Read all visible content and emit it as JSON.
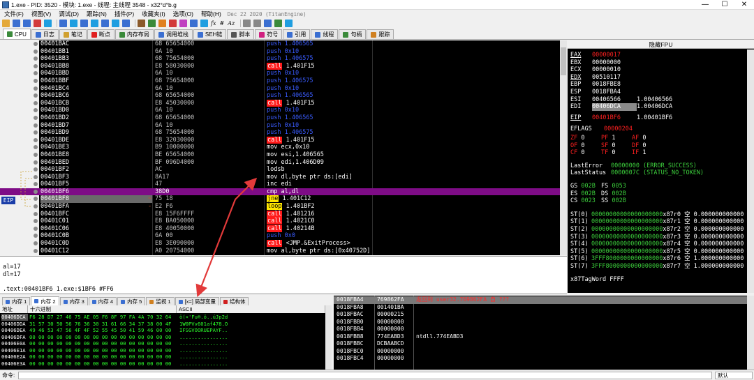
{
  "title": "1.exe - PID: 3520 - 模块: 1.exe - 线程: 主线程 3548 - x32°d°b.g",
  "window_buttons": [
    "—",
    "☐",
    "✕"
  ],
  "menu": [
    "文件(F)",
    "视图(V)",
    "调试(D)",
    "跟踪(N)",
    "插件(P)",
    "收藏夹(I)",
    "选项(O)",
    "帮助(H)"
  ],
  "build_date": "Dec 22 2020 (TitanEngine)",
  "toolbar_colors": [
    "#e4a93a",
    "#3b6fd1",
    "#3b6fd1",
    "#d23a3a",
    "#1f9ee0",
    "#3b6fd1",
    "#1f9ee0",
    "#3b6fd1",
    "#1f9ee0",
    "#3b6fd1",
    "#1f9ee0",
    "#3b6fd1",
    "#8b5a2b",
    "#3a8a3a",
    "#e08020",
    "#d23a3a",
    "#c040c0",
    "#3b6fd1",
    "#1f9ee0",
    "#888888",
    "#888888",
    "#3b6fd1",
    "#3a8a3a",
    "#1f9ee0"
  ],
  "toolbar_text": [
    "fx",
    "#",
    "Az"
  ],
  "tabs": [
    {
      "label": "CPU",
      "icon": "cpu-icon",
      "color": "#3a8a3a",
      "active": true
    },
    {
      "label": "日志",
      "icon": "log-icon",
      "color": "#3b6fd1"
    },
    {
      "label": "笔记",
      "icon": "notes-icon",
      "color": "#d0a030"
    },
    {
      "label": "断点",
      "icon": "breakpoint-icon",
      "color": "#e02020"
    },
    {
      "label": "内存布局",
      "icon": "memory-map-icon",
      "color": "#3a8a3a"
    },
    {
      "label": "调用堆栈",
      "icon": "call-stack-icon",
      "color": "#3b6fd1"
    },
    {
      "label": "SEH链",
      "icon": "seh-icon",
      "color": "#3b6fd1"
    },
    {
      "label": "脚本",
      "icon": "script-icon",
      "color": "#555555"
    },
    {
      "label": "符号",
      "icon": "symbol-icon",
      "color": "#d02080"
    },
    {
      "label": "引用",
      "icon": "references-icon",
      "color": "#3b6fd1"
    },
    {
      "label": "线程",
      "icon": "threads-icon",
      "color": "#3b6fd1"
    },
    {
      "label": "句柄",
      "icon": "handles-icon",
      "color": "#3a8a3a"
    },
    {
      "label": "跟踪",
      "icon": "trace-icon",
      "color": "#d08020"
    }
  ],
  "eip_label": "EIP",
  "disasm": [
    {
      "addr": "00401BAC",
      "bytes": "68 65654000",
      "op": "push",
      "arg": "1.406565"
    },
    {
      "addr": "00401BB1",
      "bytes": "6A 10",
      "op": "push",
      "arg": "0x10"
    },
    {
      "addr": "00401BB3",
      "bytes": "68 75654000",
      "op": "push",
      "arg": "1.406575"
    },
    {
      "addr": "00401BB8",
      "bytes": "E8 58030000",
      "op": "call",
      "arg": "1.401F15"
    },
    {
      "addr": "00401BBD",
      "bytes": "6A 10",
      "op": "push",
      "arg": "0x10"
    },
    {
      "addr": "00401BBF",
      "bytes": "68 75654000",
      "op": "push",
      "arg": "1.406575"
    },
    {
      "addr": "00401BC4",
      "bytes": "6A 10",
      "op": "push",
      "arg": "0x10"
    },
    {
      "addr": "00401BC6",
      "bytes": "68 65654000",
      "op": "push",
      "arg": "1.406565"
    },
    {
      "addr": "00401BCB",
      "bytes": "E8 45030000",
      "op": "call",
      "arg": "1.401F15"
    },
    {
      "addr": "00401BD0",
      "bytes": "6A 10",
      "op": "push",
      "arg": "0x10"
    },
    {
      "addr": "00401BD2",
      "bytes": "68 65654000",
      "op": "push",
      "arg": "1.406565"
    },
    {
      "addr": "00401BD7",
      "bytes": "6A 10",
      "op": "push",
      "arg": "0x10"
    },
    {
      "addr": "00401BD9",
      "bytes": "68 75654000",
      "op": "push",
      "arg": "1.406575"
    },
    {
      "addr": "00401BDE",
      "bytes": "E8 32030000",
      "op": "call",
      "arg": "1.401F15"
    },
    {
      "addr": "00401BE3",
      "bytes": "B9 10000000",
      "op": "mov",
      "arg": "ecx,0x10"
    },
    {
      "addr": "00401BE8",
      "bytes": "BE 65654000",
      "op": "mov",
      "arg": "esi,1.406565"
    },
    {
      "addr": "00401BED",
      "bytes": "BF 096D4000",
      "op": "mov",
      "arg": "edi,1.406D09"
    },
    {
      "addr": "00401BF2",
      "bytes": "AC",
      "op": "lodsb",
      "arg": ""
    },
    {
      "addr": "00401BF3",
      "bytes": "8A17",
      "op": "mov",
      "arg": "dl,byte ptr ds:[edi]"
    },
    {
      "addr": "00401BF5",
      "bytes": "47",
      "op": "inc",
      "arg": "edi"
    },
    {
      "addr": "00401BF6",
      "bytes": "38D0",
      "op": "cmp",
      "arg": "al,dl",
      "current": true
    },
    {
      "addr": "00401BF8",
      "bytes": "75 18",
      "op": "jne",
      "arg": "1.401C12",
      "jmark": "~"
    },
    {
      "addr": "00401BFA",
      "bytes": "E2 F6",
      "op": "loop",
      "arg": "1.401BF2",
      "jmark": "-"
    },
    {
      "addr": "00401BFC",
      "bytes": "E8 15F6FFFF",
      "op": "call",
      "arg": "1.401216"
    },
    {
      "addr": "00401C01",
      "bytes": "E8 BA050000",
      "op": "call",
      "arg": "1.4021C0"
    },
    {
      "addr": "00401C06",
      "bytes": "E8 40050000",
      "op": "call",
      "arg": "1.40214B"
    },
    {
      "addr": "00401C0B",
      "bytes": "6A 00",
      "op": "push",
      "arg": "0x0"
    },
    {
      "addr": "00401C0D",
      "bytes": "E8 3E090000",
      "op": "call",
      "arg": "<JMP.&ExitProcess>"
    },
    {
      "addr": "00401C12",
      "bytes": "A0 20754000",
      "op": "mov",
      "arg": "al,byte ptr ds:[0x40752D]"
    }
  ],
  "info": [
    "al=17",
    "dl=17",
    "",
    ".text:00401BF6 1.exe:$1BF6 #FF6"
  ],
  "memtabs": [
    "内存 1",
    "内存 2",
    "内存 3",
    "内存 4",
    "内存 5",
    "监视 1",
    "[x=] 局部变量",
    "结构体"
  ],
  "hex_header": [
    "地址",
    "十六进制",
    "ASCII"
  ],
  "hex_rows": [
    {
      "addr": "00406DCA",
      "hex": "F6 28 D7 27 46 75 AE 05 F6 8F 97 FA 4A 70 32 64",
      "ascii": "ö(×'Fu®.ö..úJp2d"
    },
    {
      "addr": "00406DDA",
      "hex": "31 57 30 50 56 76 36 30 31 61 66 34 37 38 00 4F",
      "ascii": "1W0PVv601af478.O"
    },
    {
      "addr": "00406DEA",
      "hex": "49 46 53 47 56 4F 4F 52 55 45 50 41 59 46 00 00",
      "ascii": "IFSGVOORUEPAYF.."
    },
    {
      "addr": "00406DFA",
      "hex": "00 00 00 00 00 00 00 00 00 00 00 00 00 00 00 00",
      "ascii": "................"
    },
    {
      "addr": "00406E0A",
      "hex": "00 00 00 00 00 00 00 00 00 00 00 00 00 00 00 00",
      "ascii": "................"
    },
    {
      "addr": "00406E1A",
      "hex": "00 00 00 00 00 00 00 00 00 00 00 00 00 00 00 00",
      "ascii": "................"
    },
    {
      "addr": "00406E2A",
      "hex": "00 00 00 00 00 00 00 00 00 00 00 00 00 00 00 00",
      "ascii": "................"
    },
    {
      "addr": "00406E3A",
      "hex": "00 00 00 00 00 00 00 00 00 00 00 00 00 00 00 00",
      "ascii": "................"
    }
  ],
  "stack": [
    {
      "addr": "0018FBA4",
      "val": "769862FA",
      "cmt": "返回到 user32.769862FA 自 ???",
      "top": true
    },
    {
      "addr": "0018FBA8",
      "val": "001401BA",
      "cmt": ""
    },
    {
      "addr": "0018FBAC",
      "val": "00000215",
      "cmt": ""
    },
    {
      "addr": "0018FBB0",
      "val": "00000000",
      "cmt": ""
    },
    {
      "addr": "0018FBB4",
      "val": "00000000",
      "cmt": ""
    },
    {
      "addr": "0018FBB8",
      "val": "774EABD3",
      "cmt": "ntdll.774EABD3"
    },
    {
      "addr": "0018FBBC",
      "val": "DCBAABCD",
      "cmt": ""
    },
    {
      "addr": "0018FBC0",
      "val": "00000000",
      "cmt": ""
    },
    {
      "addr": "0018FBC4",
      "val": "00000000",
      "cmt": ""
    }
  ],
  "reg_header": "隐藏FPU",
  "regs": [
    {
      "n": "EAX",
      "v": "00000017",
      "c": "",
      "chg": true
    },
    {
      "n": "EBX",
      "v": "00000000",
      "c": ""
    },
    {
      "n": "ECX",
      "v": "00000010",
      "c": ""
    },
    {
      "n": "EDX",
      "v": "00510117",
      "c": ""
    },
    {
      "n": "EBP",
      "v": "0018FBE8",
      "c": ""
    },
    {
      "n": "ESP",
      "v": "0018FBA4",
      "c": ""
    },
    {
      "n": "ESI",
      "v": "00406566",
      "c": "1.00406566"
    },
    {
      "n": "EDI",
      "v": "00406DCA",
      "c": "1.00406DCA",
      "hl": true
    },
    {
      "n": "",
      "v": "",
      "c": ""
    },
    {
      "n": "EIP",
      "v": "00401BF6",
      "c": "1.00401BF6",
      "chg": true
    },
    {
      "n": "",
      "v": "",
      "c": ""
    },
    {
      "n": "EFLAGS",
      "v": "00000204",
      "c": "",
      "chg": true
    }
  ],
  "flags": [
    [
      {
        "n": "ZF",
        "v": "0"
      },
      {
        "n": "PF",
        "v": "1"
      },
      {
        "n": "AF",
        "v": "0"
      }
    ],
    [
      {
        "n": "OF",
        "v": "0"
      },
      {
        "n": "SF",
        "v": "0"
      },
      {
        "n": "DF",
        "v": "0"
      }
    ],
    [
      {
        "n": "CF",
        "v": "0"
      },
      {
        "n": "TF",
        "v": "0"
      },
      {
        "n": "IF",
        "v": "1"
      }
    ]
  ],
  "last_error": {
    "label": "LastError",
    "value": "00000000 (ERROR_SUCCESS)"
  },
  "last_status": {
    "label": "LastStatus",
    "value": "0000007C (STATUS_NO_TOKEN)"
  },
  "segs": [
    [
      {
        "n": "GS",
        "v": "002B"
      },
      {
        "n": "FS",
        "v": "0053"
      }
    ],
    [
      {
        "n": "ES",
        "v": "002B"
      },
      {
        "n": "DS",
        "v": "002B"
      }
    ],
    [
      {
        "n": "CS",
        "v": "0023"
      },
      {
        "n": "SS",
        "v": "002B"
      }
    ]
  ],
  "fpu": [
    {
      "n": "ST(0)",
      "v": "00000000000000000000",
      "r": "x87r0 空 0.000000000000"
    },
    {
      "n": "ST(1)",
      "v": "00000000000000000000",
      "r": "x87r1 空 0.000000000000"
    },
    {
      "n": "ST(2)",
      "v": "00000000000000000000",
      "r": "x87r2 空 0.000000000000"
    },
    {
      "n": "ST(3)",
      "v": "00000000000000000000",
      "r": "x87r3 空 0.000000000000"
    },
    {
      "n": "ST(4)",
      "v": "00000000000000000000",
      "r": "x87r4 空 0.000000000000"
    },
    {
      "n": "ST(5)",
      "v": "00000000000000000000",
      "r": "x87r5 空 0.000000000000"
    },
    {
      "n": "ST(6)",
      "v": "3FFF8000000000000000",
      "r": "x87r6 空 1.000000000000"
    },
    {
      "n": "ST(7)",
      "v": "3FFF8000000000000000",
      "r": "x87r7 空 1.000000000000"
    }
  ],
  "tagword": "x87TagWord FFFF",
  "cmd": {
    "label": "命令:",
    "mode": "默认"
  }
}
